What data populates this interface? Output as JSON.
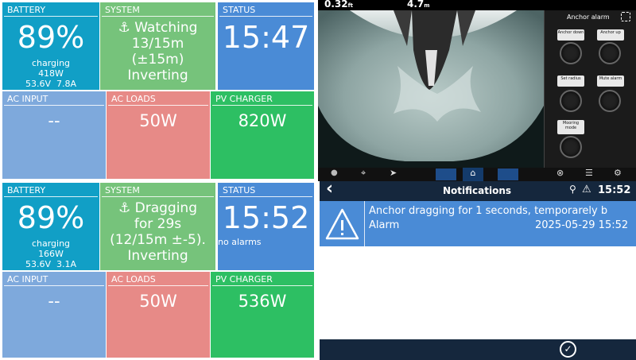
{
  "panel_top": {
    "battery": {
      "title": "BATTERY",
      "percent": "89%",
      "state": "charging",
      "power": "418W",
      "voltage": "53.6V",
      "current": "7.8A"
    },
    "system": {
      "title": "SYSTEM",
      "line1": "⚓ Watching",
      "line2": "13/15m",
      "line3": "(±15m)",
      "line4": "Inverting"
    },
    "status": {
      "title": "STATUS",
      "time": "15:47"
    },
    "ac_input": {
      "title": "AC INPUT",
      "value": "--"
    },
    "ac_loads": {
      "title": "AC LOADS",
      "value": "50W"
    },
    "pv": {
      "title": "PV CHARGER",
      "value": "820W"
    }
  },
  "panel_bottom": {
    "battery": {
      "title": "BATTERY",
      "percent": "89%",
      "state": "charging",
      "power": "166W",
      "voltage": "53.6V",
      "current": "3.1A"
    },
    "system": {
      "title": "SYSTEM",
      "line1": "⚓ Dragging",
      "line2": "for 29s",
      "line3": "(12/15m ±-5).",
      "line4": "Inverting"
    },
    "status": {
      "title": "STATUS",
      "time": "15:52",
      "subtitle": "no alarms"
    },
    "ac_input": {
      "title": "AC INPUT",
      "value": "--"
    },
    "ac_loads": {
      "title": "AC LOADS",
      "value": "50W"
    },
    "pv": {
      "title": "PV CHARGER",
      "value": "536W"
    }
  },
  "camera": {
    "readout1": "0.32",
    "readout1_unit": "ft",
    "readout2": "4.7",
    "readout2_unit": "m",
    "anchor_panel_title": "Anchor alarm",
    "buttons": [
      {
        "label": "Anchor down"
      },
      {
        "label": "Anchor up"
      },
      {
        "label": "Set radius"
      },
      {
        "label": "Mute alarm"
      },
      {
        "label": "Mooring mode"
      }
    ]
  },
  "notifications": {
    "back_glyph": "‹",
    "title": "Notifications",
    "time": "15:52",
    "message": "Anchor dragging for 1 seconds, temporarely b",
    "type": "Alarm",
    "timestamp": "2025-05-29 15:52"
  },
  "colors": {
    "battery": "#119fc6",
    "system": "#76c37b",
    "status": "#4a8bd6",
    "ac_input": "#7ea9dc",
    "ac_loads": "#e78a87",
    "pv": "#2dbf63",
    "nav": "#15273d"
  }
}
